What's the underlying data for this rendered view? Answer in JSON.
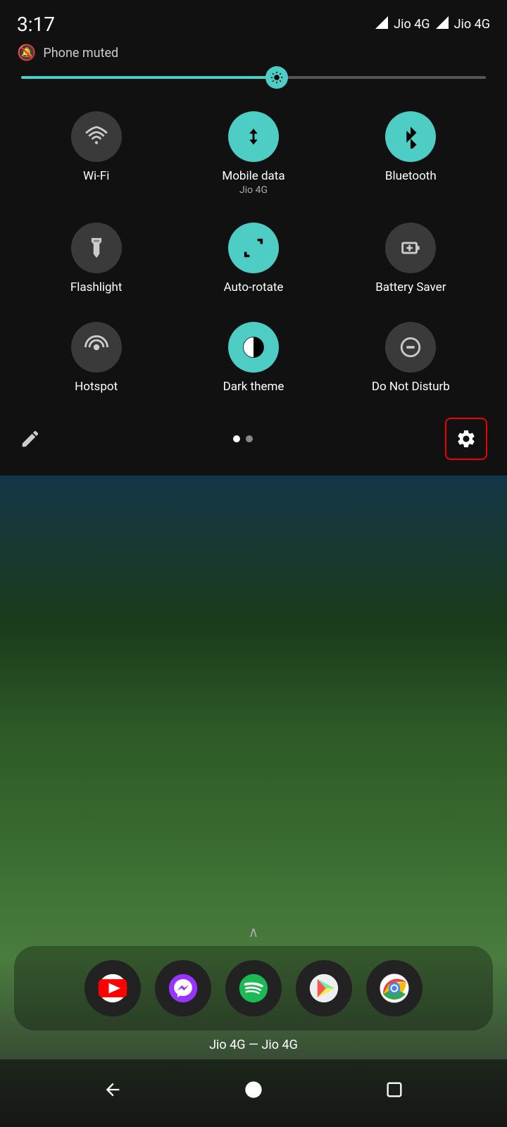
{
  "statusBar": {
    "time": "3:17",
    "phoneMuted": "Phone muted",
    "carrier1": "Jio 4G",
    "carrier2": "Jio 4G"
  },
  "brightness": {
    "level": 55
  },
  "tiles": [
    {
      "id": "wifi",
      "label": "Wi-Fi",
      "sublabel": "",
      "active": false
    },
    {
      "id": "mobile-data",
      "label": "Mobile data",
      "sublabel": "Jio 4G",
      "active": true
    },
    {
      "id": "bluetooth",
      "label": "Bluetooth",
      "sublabel": "",
      "active": true
    },
    {
      "id": "flashlight",
      "label": "Flashlight",
      "sublabel": "",
      "active": false
    },
    {
      "id": "auto-rotate",
      "label": "Auto-rotate",
      "sublabel": "",
      "active": true
    },
    {
      "id": "battery-saver",
      "label": "Battery Saver",
      "sublabel": "",
      "active": false
    },
    {
      "id": "hotspot",
      "label": "Hotspot",
      "sublabel": "",
      "active": false
    },
    {
      "id": "dark-theme",
      "label": "Dark theme",
      "sublabel": "",
      "active": true
    },
    {
      "id": "do-not-disturb",
      "label": "Do Not Disturb",
      "sublabel": "",
      "active": false
    }
  ],
  "qsBottom": {
    "page1Active": true,
    "page2Active": false
  },
  "homeScreen": {
    "carrierText": "Jio 4G — Jio 4G"
  },
  "navBar": {
    "back": "◀",
    "home": "●",
    "recents": "■"
  }
}
